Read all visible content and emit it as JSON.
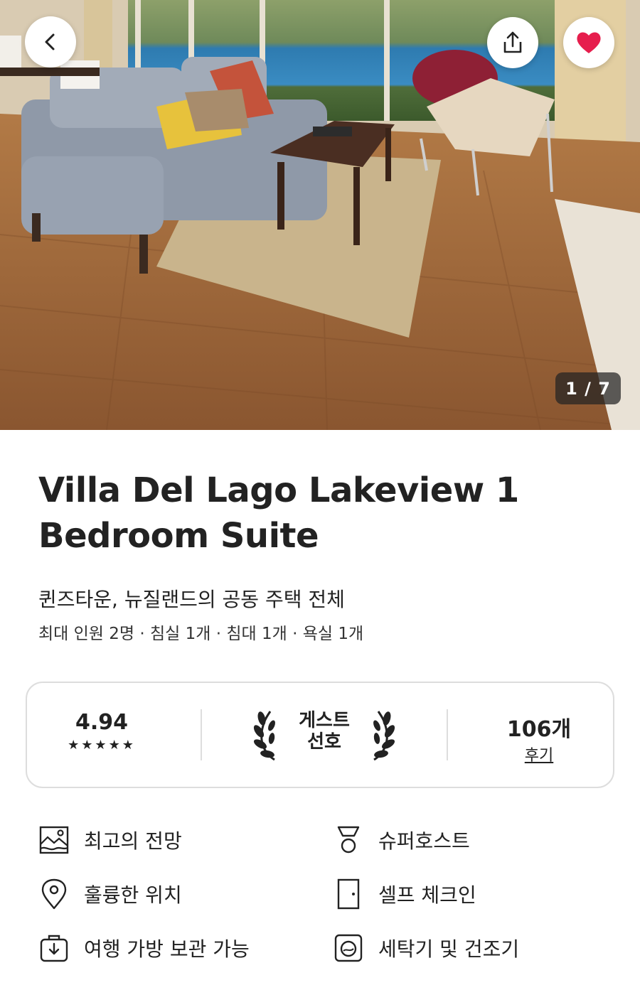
{
  "hero": {
    "photo_counter": "1 / 7",
    "back_icon": "chevron-left-icon",
    "share_icon": "share-icon",
    "favorite_icon": "heart-icon",
    "favorite_color": "#E61E4D"
  },
  "listing": {
    "title_line1": "Villa Del Lago Lakeview 1",
    "title_line2": "Bedroom Suite",
    "subtitle": "퀸즈타운, 뉴질랜드의 공동 주택 전체",
    "meta": "최대 인원 2명 · 침실 1개 · 침대 1개 · 욕실 1개"
  },
  "rating_card": {
    "score": "4.94",
    "stars": "★★★★★",
    "star_count": 5,
    "guest_fav_line1": "게스트",
    "guest_fav_line2": "선호",
    "review_count": "106개",
    "review_label": "후기"
  },
  "amenities": [
    {
      "label": "최고의 전망",
      "icon": "landscape-photo-icon"
    },
    {
      "label": "슈퍼호스트",
      "icon": "medal-icon"
    },
    {
      "label": "훌륭한 위치",
      "icon": "map-pin-icon"
    },
    {
      "label": "셀프 체크인",
      "icon": "door-icon"
    },
    {
      "label": "여행 가방 보관 가능",
      "icon": "luggage-icon"
    },
    {
      "label": "세탁기 및 건조기",
      "icon": "washer-icon"
    }
  ]
}
